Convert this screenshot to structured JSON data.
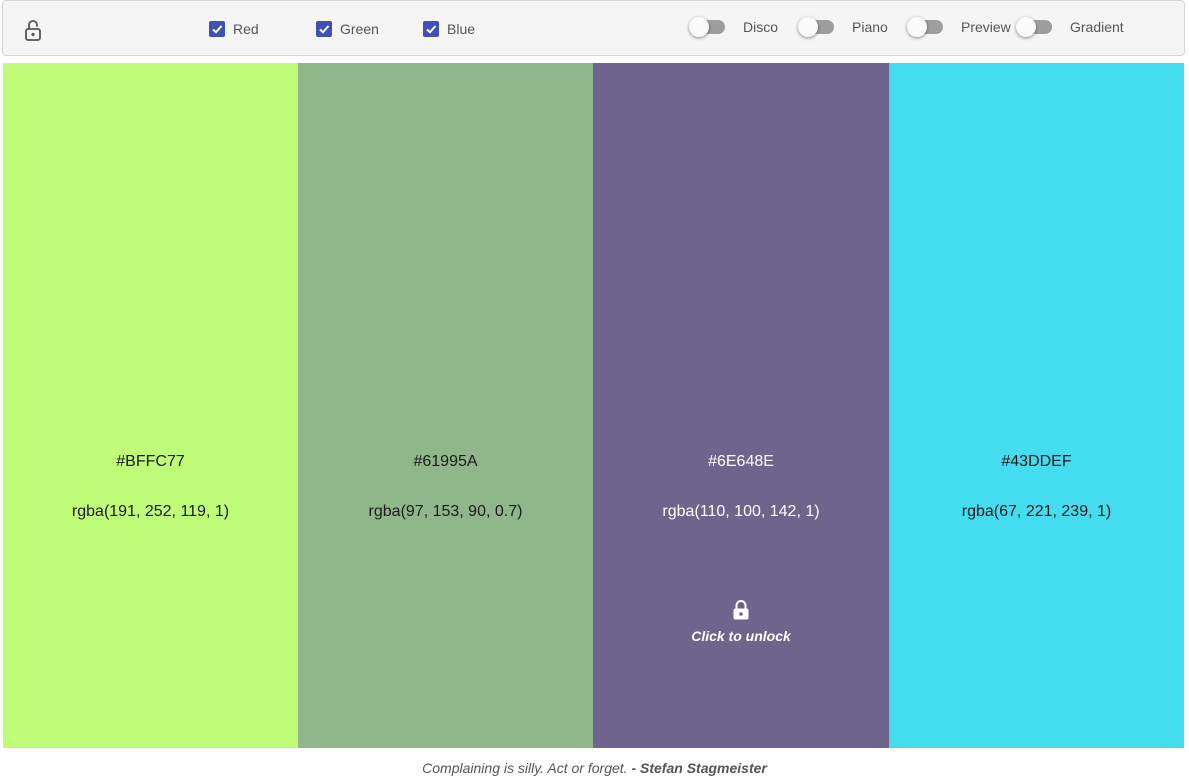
{
  "toolbar": {
    "lock_icon": "unlock-icon",
    "checkboxes": [
      {
        "label": "Red",
        "checked": true
      },
      {
        "label": "Green",
        "checked": true
      },
      {
        "label": "Blue",
        "checked": true
      }
    ],
    "toggles": [
      {
        "label": "Disco",
        "on": false
      },
      {
        "label": "Piano",
        "on": false
      },
      {
        "label": "Preview",
        "on": false
      },
      {
        "label": "Gradient",
        "on": false
      }
    ]
  },
  "swatches": [
    {
      "hex": "#BFFC77",
      "rgba": "rgba(191, 252, 119, 1)",
      "color": "#bffc77"
    },
    {
      "hex": "#61995A",
      "rgba": "rgba(97, 153, 90, 0.7)",
      "color": "#90b68b"
    },
    {
      "hex": "#6E648E",
      "rgba": "rgba(110, 100, 142, 1)",
      "color": "#6e648e",
      "locked": true,
      "lock_text": "Click to unlock",
      "lock_icon": "lock-icon"
    },
    {
      "hex": "#43DDEF",
      "rgba": "rgba(67, 221, 239, 1)",
      "color": "#43ddef"
    }
  ],
  "footer": {
    "quote_text": "Complaining is silly. Act or forget.",
    "quote_separator": "-",
    "quote_author": "Stefan Stagmeister"
  },
  "colors": {
    "accent": "#3f51b5"
  }
}
